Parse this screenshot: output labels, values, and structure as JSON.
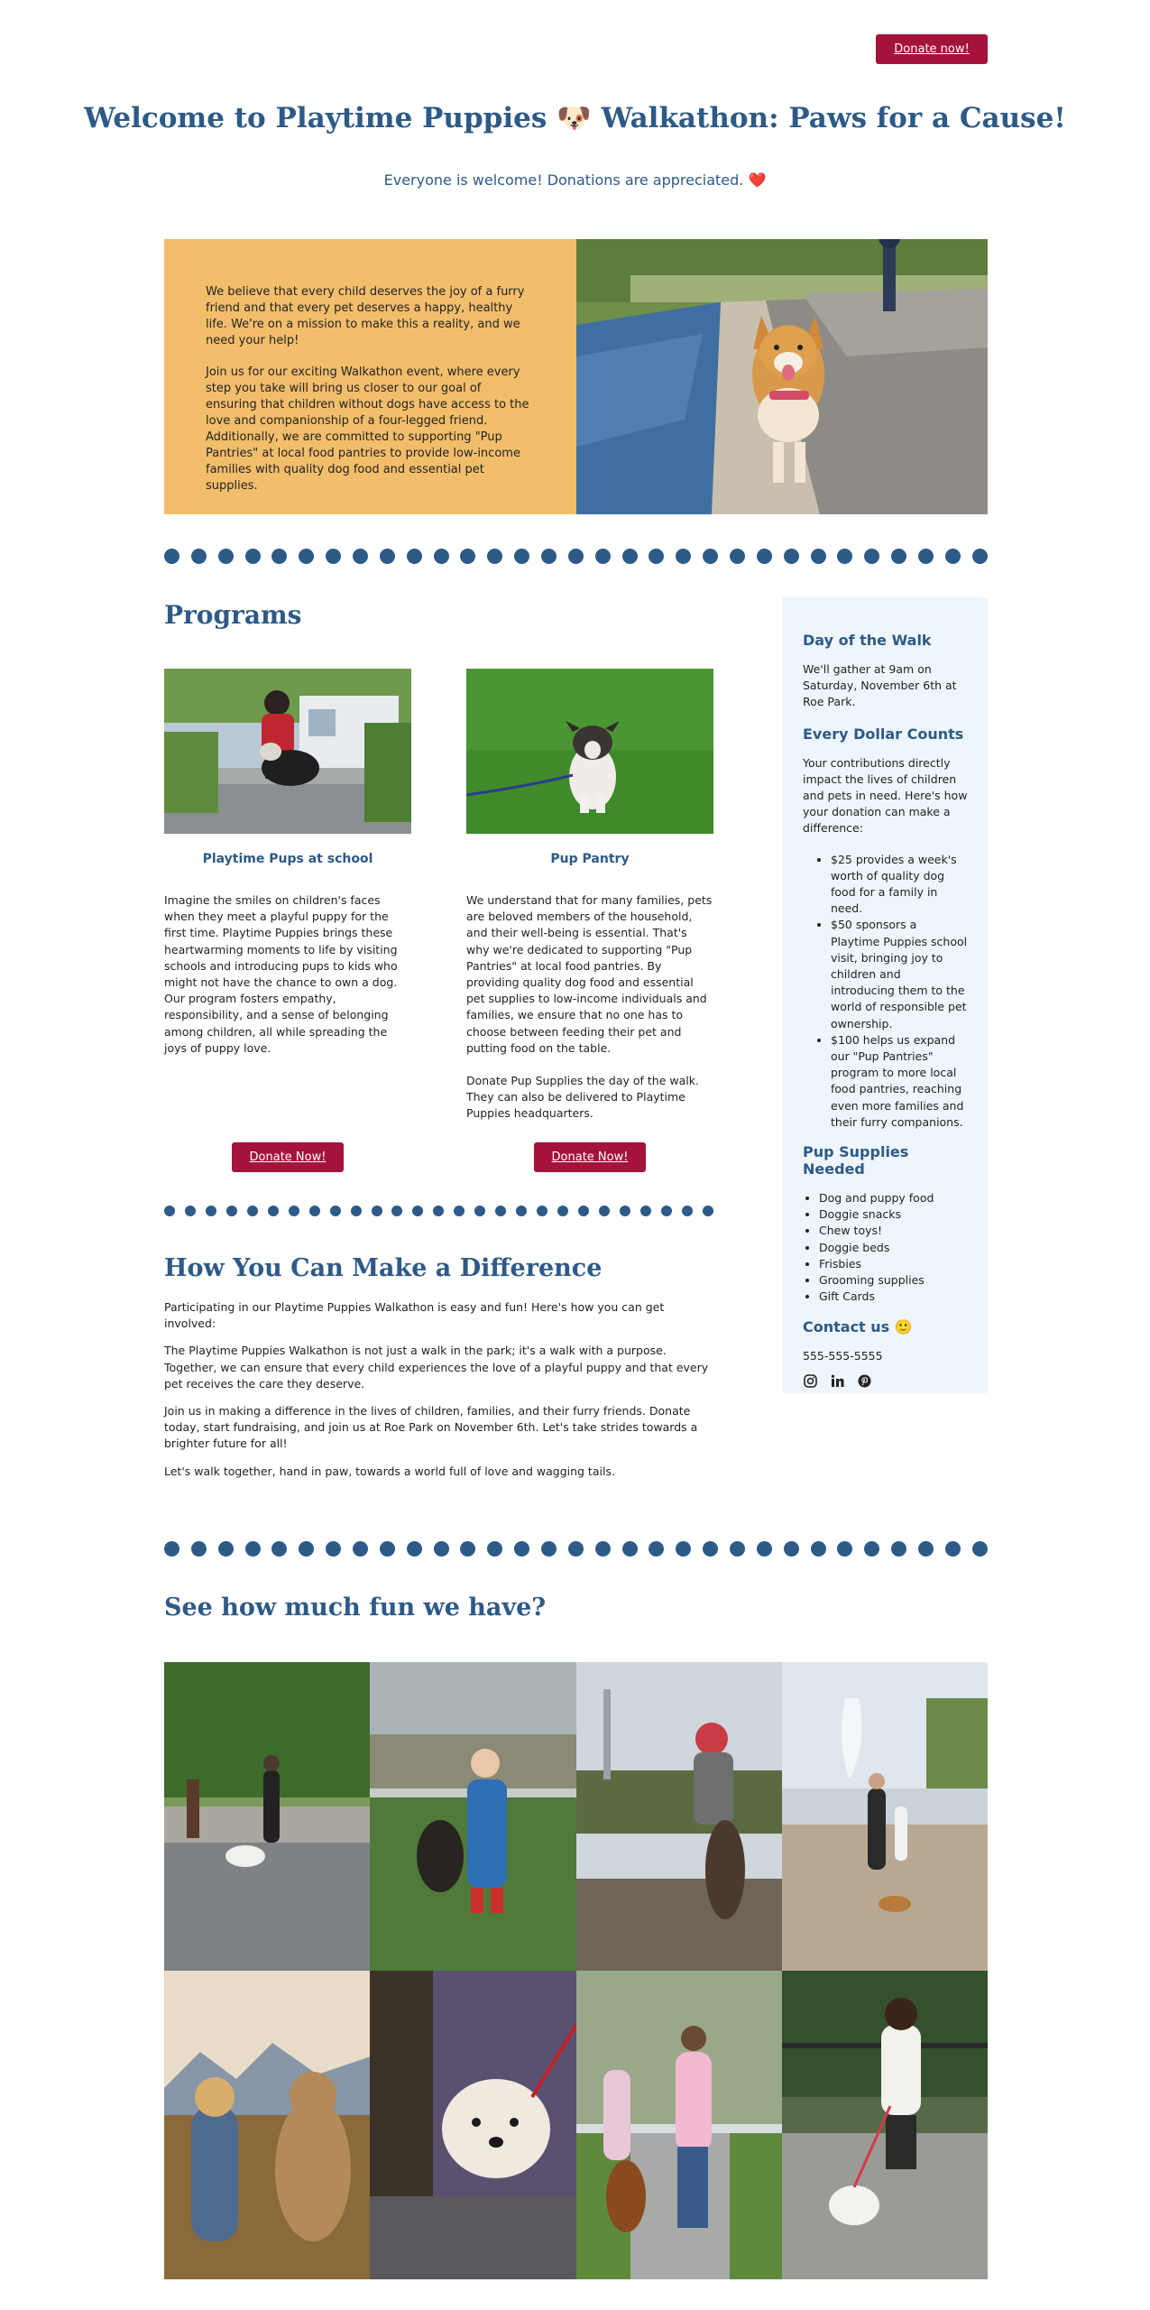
{
  "header": {
    "donate_label": "Donate now!",
    "title": "Welcome to Playtime Puppies 🐶 Walkathon: Paws for a Cause!",
    "subtitle": "Everyone is welcome! Donations are appreciated. ❤️"
  },
  "hero": {
    "paragraphs": [
      "We believe that every child deserves the joy of a furry friend and that every pet deserves a happy, healthy life. We're on a mission to make this a reality, and we need your help!",
      "Join us for our exciting Walkathon event, where every step you take will bring us closer to our goal of ensuring that children without dogs have access to the love and companionship of a four-legged friend. Additionally, we are committed to supporting \"Pup Pantries\" at local food pantries to provide low-income families with quality dog food and essential pet supplies."
    ]
  },
  "programs": {
    "heading": "Programs",
    "cards": [
      {
        "title": "Playtime Pups at school",
        "paragraphs": [
          "Imagine the smiles on children's faces when they meet a playful puppy for the first time. Playtime Puppies brings these heartwarming moments to life by visiting schools and introducing pups to kids who might not have the chance to own a dog. Our program fosters empathy, responsibility, and a sense of belonging among children, all while spreading the joys of puppy love."
        ],
        "button": "Donate Now!"
      },
      {
        "title": "Pup Pantry",
        "paragraphs": [
          "We understand that for many families, pets are beloved members of the household, and their well-being is essential. That's why we're dedicated to supporting \"Pup Pantries\" at local food pantries. By providing quality dog food and essential pet supplies to low-income individuals and families, we ensure that no one has to choose between feeding their pet and putting food on the table.",
          "Donate Pup Supplies the day of the walk. They can also be delivered to Playtime Puppies headquarters."
        ],
        "button": "Donate Now!"
      }
    ]
  },
  "difference": {
    "heading": "How You Can Make a Difference",
    "paragraphs": [
      "Participating in our Playtime Puppies Walkathon is easy and fun! Here's how you can get involved:",
      "The Playtime Puppies Walkathon is not just a walk in the park; it's a walk with a purpose. Together, we can ensure that every child experiences the love of a playful puppy and that every pet receives the care they deserve.",
      "Join us in making a difference in the lives of children, families, and their furry friends. Donate today, start fundraising, and join us at Roe Park on November 6th. Let's take strides towards a brighter future for all!",
      "Let's walk together, hand in paw, towards a world full of love and wagging tails."
    ]
  },
  "sidebar": {
    "day_heading": "Day of the Walk",
    "day_text": "We'll gather at 9am on Saturday, November 6th at Roe Park.",
    "dollar_heading": "Every Dollar Counts",
    "dollar_text": "Your contributions directly impact the lives of children and pets in need. Here's how your donation can make a difference:",
    "dollar_items": [
      "$25 provides a week's worth of quality dog food for a family in need.",
      "$50 sponsors a Playtime Puppies school visit, bringing joy to children and introducing them to the world of responsible pet ownership.",
      "$100 helps us expand our \"Pup Pantries\" program to more local food pantries, reaching even more families and their furry companions."
    ],
    "supplies_heading": "Pup Supplies Needed",
    "supplies_items": [
      "Dog and puppy food",
      "Doggie snacks",
      "Chew toys!",
      "Doggie beds",
      "Frisbies",
      "Grooming supplies",
      "Gift Cards"
    ],
    "contact_heading": "Contact us 🙂",
    "phone": "555-555-5555",
    "social_icons": [
      "instagram-icon",
      "linkedin-icon",
      "pinterest-icon"
    ]
  },
  "gallery": {
    "heading": "See how much fun we have?"
  },
  "colors": {
    "navy": "#2d5a87",
    "donate_red": "#a3133a",
    "hero_orange": "#f2be6c",
    "sidebar_bg": "#eef6fc"
  }
}
